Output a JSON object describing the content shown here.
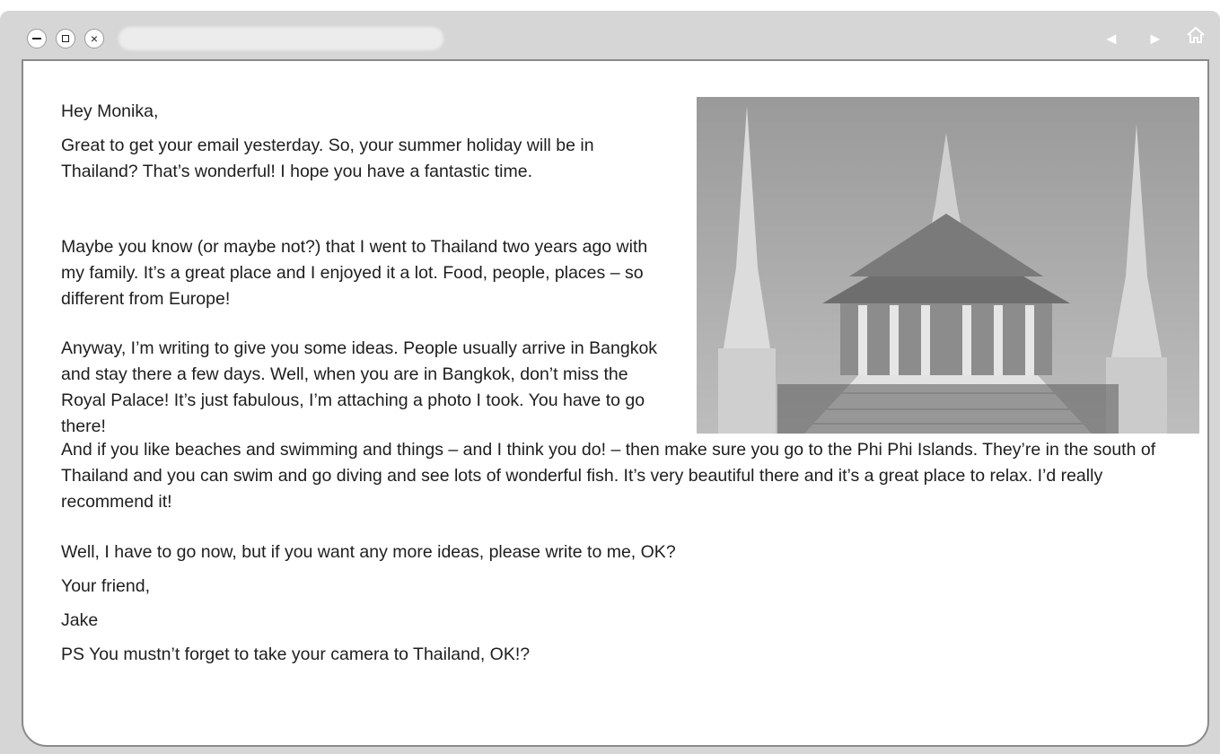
{
  "window": {
    "title_bar": {
      "minimize_icon": "minimize-icon",
      "maximize_icon": "maximize-icon",
      "close_icon": "close-icon",
      "close_glyph": "×",
      "back_glyph": "◄",
      "forward_glyph": "►",
      "home_glyph": "⌂"
    }
  },
  "email": {
    "greeting": "Hey Monika,",
    "paragraph_1": "Great to get your email yesterday. So, your summer holiday will be in Thailand? That’s wonderful! I hope you have a fantastic time.",
    "paragraph_2": "Maybe you know (or maybe not?) that I went to Thailand two years ago with my family. It’s a great place and I enjoyed it a lot. Food, people, places – so different from Europe!",
    "paragraph_3": "Anyway, I’m writing to give you some ideas. People usually arrive in Bangkok and stay there a few days. Well, when you are in Bangkok, don’t miss the Royal Palace! It’s just fabulous, I’m attaching a photo I took. You have to go there!",
    "paragraph_4": "And if you like beaches and swimming and things – and I think you do! – then make sure you go to the Phi Phi Islands. They’re in the south of Thailand and you can swim and go diving and see lots of wonderful fish. It’s very beautiful there and it’s a great place to relax. I’d really recommend it!",
    "paragraph_5": "Well, I have to go now, but if you want any more ideas, please write to me, OK?",
    "closing": "Your friend,",
    "signature": "Jake",
    "postscript": "PS You mustn’t forget to take your camera to Thailand, OK!?"
  },
  "colors": {
    "frame": "#d6d6d6",
    "border": "#8a8a8a",
    "text": "#1e1e1e"
  }
}
